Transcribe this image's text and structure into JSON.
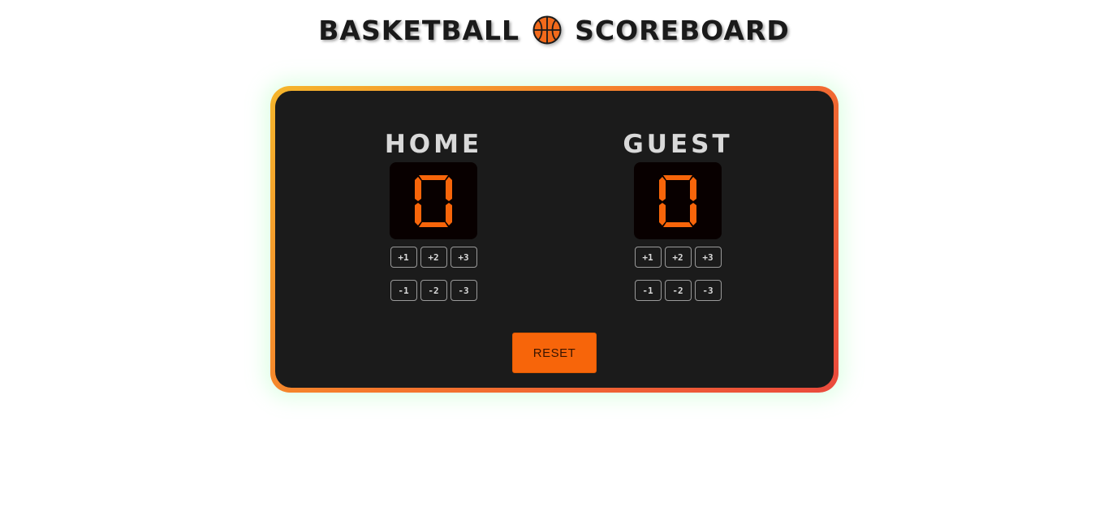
{
  "header": {
    "title_left": "BASKETBALL",
    "title_right": "SCOREBOARD",
    "icon": "basketball-icon"
  },
  "teams": [
    {
      "name": "HOME",
      "score": "0",
      "add_buttons": [
        "+1",
        "+2",
        "+3"
      ],
      "subtract_buttons": [
        "-1",
        "-2",
        "-3"
      ]
    },
    {
      "name": "GUEST",
      "score": "0",
      "add_buttons": [
        "+1",
        "+2",
        "+3"
      ],
      "subtract_buttons": [
        "-1",
        "-2",
        "-3"
      ]
    }
  ],
  "controls": {
    "reset_label": "RESET"
  },
  "colors": {
    "accent": "#f7650a",
    "score_digit": "#f7650a",
    "board_background": "#1b1b1b",
    "frame_gradient": [
      "#f5b62c",
      "#f57a2c",
      "#ea4a3c"
    ],
    "glow": "#96ffaa"
  }
}
